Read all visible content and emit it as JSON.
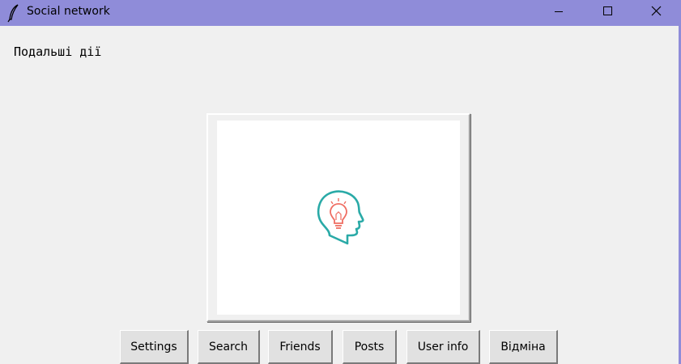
{
  "window": {
    "title": "Social network",
    "icon": "feather-icon",
    "controls": [
      "minimize-icon",
      "maximize-icon",
      "close-icon"
    ],
    "title_bar_color": "#8f8cd9"
  },
  "main": {
    "heading": "Подальші дії",
    "image": {
      "icon": "head-lightbulb-icon",
      "colors": [
        "#2aaaa7",
        "#ef6d62"
      ]
    }
  },
  "buttons": [
    {
      "label": "Settings"
    },
    {
      "label": "Search"
    },
    {
      "label": "Friends"
    },
    {
      "label": "Posts"
    },
    {
      "label": "User info"
    },
    {
      "label": "Відміна"
    }
  ]
}
